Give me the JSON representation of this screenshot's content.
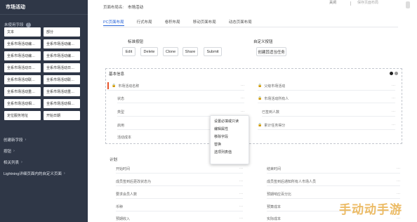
{
  "sidebar": {
    "title": "市场活动",
    "unused_fields_label": "未使用字段",
    "help_icon_glyph": "?",
    "field_chips": [
      "文本",
      "部分",
      "全系市场活动编…",
      "全系市场活动编…",
      "全系市场活动编…",
      "全系市场活动编…",
      "全系市场活动日…",
      "全系市场活动日…",
      "全系市场活动联…",
      "全系市场活动联…",
      "全系市场活动重…",
      "全系市场活动重…",
      "全系市场活动相…",
      "全系市场活动相…",
      "定位服务地址",
      "开始日期"
    ],
    "nav_items": [
      "创建新字段",
      "按钮",
      "相关列表",
      "Lightning详细页面内的自定义页面"
    ]
  },
  "topbar": {
    "layout_name_label": "页面布局名:",
    "layout_name_value": "市场活动",
    "close_label": "关闭",
    "save_label": "保存页面布局"
  },
  "tabs": [
    {
      "label": "PC页面布局",
      "active": true
    },
    {
      "label": "行式布局",
      "active": false
    },
    {
      "label": "卷积布局",
      "active": false
    },
    {
      "label": "移动页面布局",
      "active": false
    },
    {
      "label": "动态页面布局",
      "active": false
    }
  ],
  "standard_buttons": {
    "title": "标准按钮",
    "items": [
      "Edit",
      "Delete",
      "Clone",
      "Share",
      "Submit"
    ]
  },
  "custom_buttons": {
    "title": "自定义按钮",
    "items": [
      "创建其适当任务"
    ]
  },
  "section_basic": {
    "title": "基本信息",
    "dot_colors": [
      "#222222",
      "#999999"
    ],
    "left_fields": [
      "市场活动名称",
      "状态",
      "类型",
      "启用",
      "活动成本"
    ],
    "right_fields": [
      "父级市场活动",
      "市场活动所有人",
      "已签到人数",
      "累计任务得分"
    ]
  },
  "context_menu": {
    "items": [
      "设置必填或只读",
      "编辑属性",
      "移除字段",
      "替换",
      "选项列表值"
    ]
  },
  "section_plan": {
    "title": "计划",
    "left_fields": [
      "开始时间",
      "成员签到后更改状态为",
      "要求会员人数",
      "币种",
      "预期收入"
    ],
    "right_fields": [
      "结束时间",
      "成员签到后通知所有人市场人员",
      "预期响应百分比",
      "预算成本",
      "实际成本"
    ]
  },
  "watermark": "手动动手游",
  "colors": {
    "accent": "#2b66d9",
    "sidebar_bg": "#2f3747",
    "required_marker": "#e8552b"
  }
}
